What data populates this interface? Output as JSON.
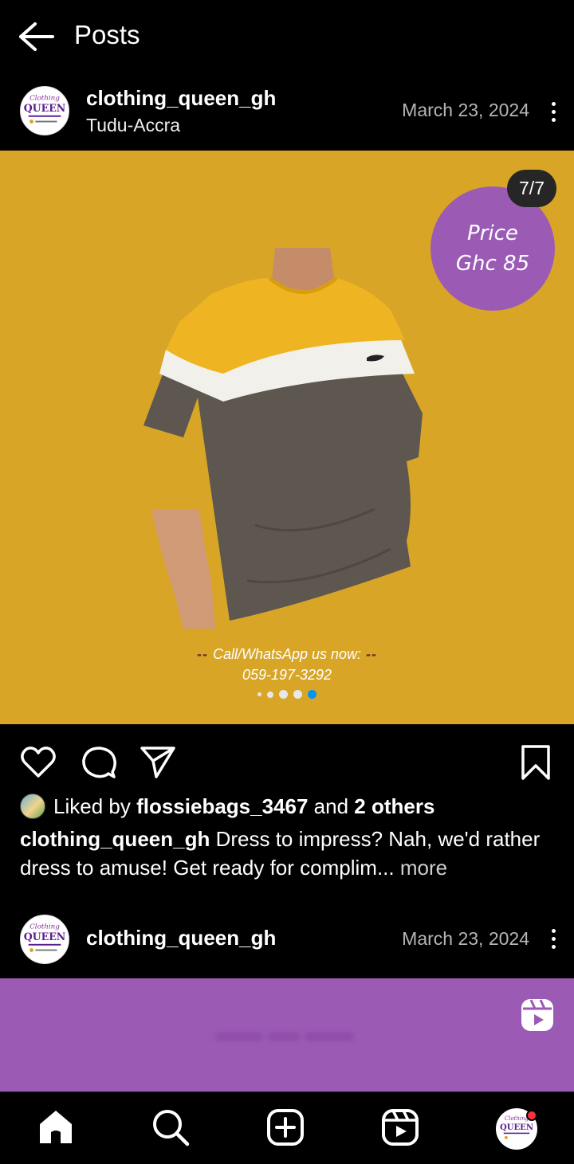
{
  "header": {
    "title": "Posts",
    "back_icon": "arrow-left-icon"
  },
  "post1": {
    "username": "clothing_queen_gh",
    "location": "Tudu-Accra",
    "date": "March 23, 2024",
    "media": {
      "counter": "7/7",
      "background": "#d8a527",
      "price_line1": "Price",
      "price_line2": "Ghc 85",
      "price_color": "#9b5bb5",
      "cta_line1": "Call/WhatsApp us now:",
      "cta_line2": "059-197-3292",
      "carousel_total": 5,
      "carousel_active": 5
    },
    "liked_by_prefix": "Liked by",
    "liked_by_user": "flossiebags_3467",
    "liked_by_and": "and",
    "liked_by_others": "2 others",
    "caption_user": "clothing_queen_gh",
    "caption_text": "Dress to impress? Nah, we'd rather dress to amuse! Get ready for complim...",
    "caption_more": "more"
  },
  "post2": {
    "username": "clothing_queen_gh",
    "date": "March 23, 2024",
    "background": "#9b5bb5"
  },
  "avatar_logo_text": "QUEEN",
  "avatar_logo_script": "Clothing",
  "nav": {
    "items": [
      "home-icon",
      "search-icon",
      "create-icon",
      "reels-icon",
      "profile-avatar"
    ]
  }
}
